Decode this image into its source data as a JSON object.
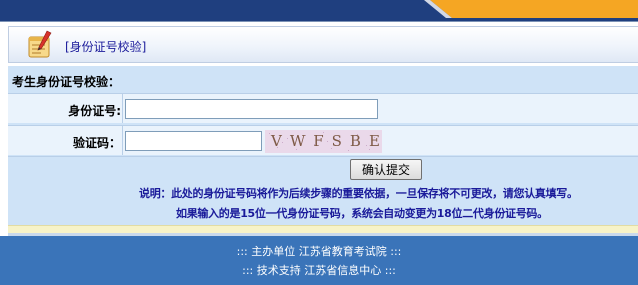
{
  "header": {
    "section_title": "[身份证号校验]"
  },
  "form": {
    "title": "考生身份证号校验：",
    "id_label": "身份证号:",
    "id_value": "",
    "code_label": "验证码：",
    "code_value": "",
    "captcha_text": "VWFSBE",
    "submit_label": "确认提交",
    "note_line1": "说明：此处的身份证号码将作为后续步骤的重要依据，一旦保存将不可更改，请您认真填写。",
    "note_line2": "如果输入的是15位一代身份证号码，系统会自动变更为18位二代身份证号码。"
  },
  "footer": {
    "line1": "::: 主办单位 江苏省教育考试院 :::",
    "line2": "::: 技术支持 江苏省信息中心 :::"
  },
  "colors": {
    "banner_navy": "#1f3f7f",
    "banner_orange": "#f5a623",
    "link_blue": "#1a1a9a",
    "form_bg": "#cfe3f7",
    "footer_bg": "#3a74b9"
  }
}
